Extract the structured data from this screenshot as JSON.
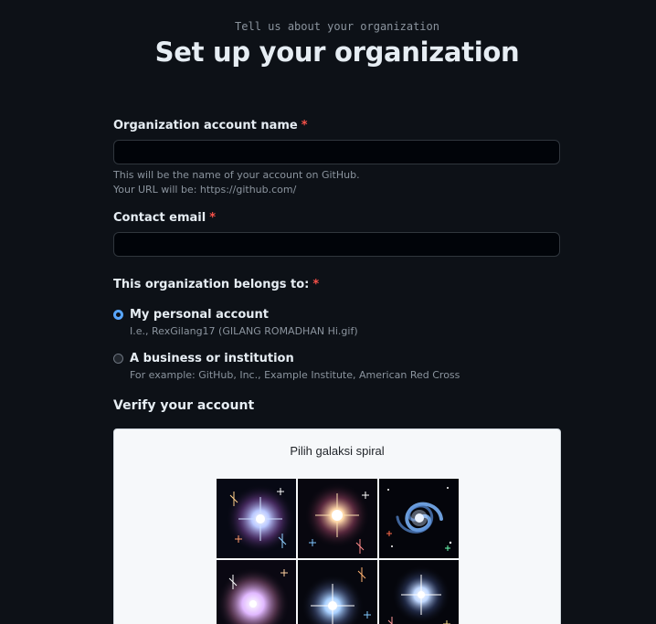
{
  "header": {
    "subtitle": "Tell us about your organization",
    "title": "Set up your organization"
  },
  "form": {
    "org_name": {
      "label": "Organization account name",
      "required_mark": "*",
      "value": "",
      "hint_line1": "This will be the name of your account on GitHub.",
      "hint_line2": "Your URL will be: https://github.com/"
    },
    "contact_email": {
      "label": "Contact email",
      "required_mark": "*",
      "value": ""
    },
    "belongs_to": {
      "label": "This organization belongs to:",
      "required_mark": "*",
      "options": [
        {
          "label": "My personal account",
          "hint": "I.e., RexGilang17 (GILANG ROMADHAN Hi.gif)",
          "checked": true
        },
        {
          "label": "A business or institution",
          "hint": "For example: GitHub, Inc., Example Institute, American Red Cross",
          "checked": false
        }
      ]
    }
  },
  "verify": {
    "heading": "Verify your account",
    "captcha_prompt": "Pilih galaksi spiral",
    "tiles": [
      {
        "name": "captcha-tile-1",
        "kind": "starburst"
      },
      {
        "name": "captcha-tile-2",
        "kind": "starburst"
      },
      {
        "name": "captcha-tile-3",
        "kind": "spiral"
      },
      {
        "name": "captcha-tile-4",
        "kind": "starburst"
      },
      {
        "name": "captcha-tile-5",
        "kind": "starburst"
      },
      {
        "name": "captcha-tile-6",
        "kind": "starburst"
      }
    ]
  },
  "colors": {
    "background": "#0d1117",
    "input_background": "#010409",
    "border": "#30363d",
    "required": "#f85149",
    "accent": "#58a6ff",
    "muted_text": "#8b949e"
  }
}
